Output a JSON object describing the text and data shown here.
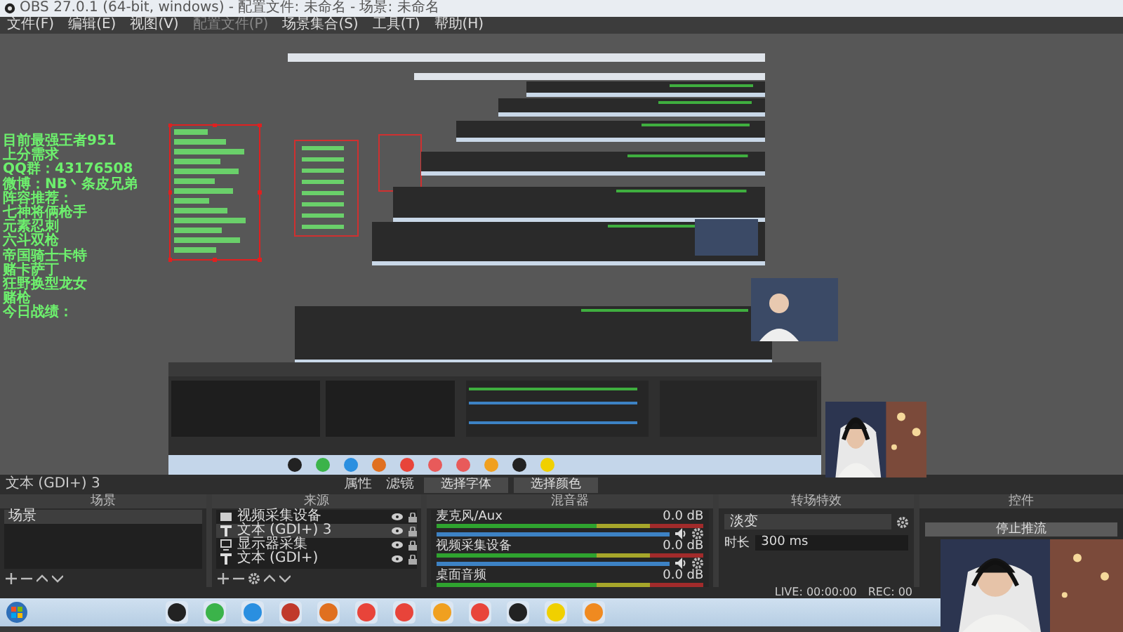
{
  "window": {
    "title": "OBS 27.0.1 (64-bit, windows) - 配置文件: 未命名 - 场景: 未命名"
  },
  "menu": [
    {
      "label": "文件(F)",
      "disabled": false
    },
    {
      "label": "编辑(E)",
      "disabled": false
    },
    {
      "label": "视图(V)",
      "disabled": false
    },
    {
      "label": "配置文件(P)",
      "disabled": true
    },
    {
      "label": "场景集合(S)",
      "disabled": false
    },
    {
      "label": "工具(T)",
      "disabled": false
    },
    {
      "label": "帮助(H)",
      "disabled": false
    }
  ],
  "preview": {
    "text_lines": [
      "目前最强王者951",
      "上分需求",
      "QQ群：43176508",
      "微博：NB丶条皮兄弟",
      "阵容推荐：",
      "七神将俩枪手",
      "元素忍刺",
      "六斗双枪",
      "帝国骑士卡特",
      "赌卡萨丁",
      "狂野换型龙女",
      "赌枪",
      "今日战绩："
    ]
  },
  "source_toolbar": {
    "source": "文本 (GDI+) 3",
    "buttons": [
      "属性",
      "滤镜",
      "选择字体",
      "选择颜色"
    ]
  },
  "scenes": {
    "title": "场景",
    "items": [
      {
        "label": "场景",
        "selected": true
      }
    ]
  },
  "sources": {
    "title": "来源",
    "items": [
      {
        "label": "视频采集设备",
        "kind": "camera",
        "selected": false
      },
      {
        "label": "文本 (GDI+) 3",
        "kind": "text",
        "selected": true
      },
      {
        "label": "显示器采集",
        "kind": "monitor",
        "selected": false
      },
      {
        "label": "文本 (GDI+)",
        "kind": "text",
        "selected": false
      }
    ]
  },
  "mixer": {
    "title": "混音器",
    "channels": [
      {
        "name": "麦克风/Aux",
        "reading": "0.0 dB",
        "level": 1
      },
      {
        "name": "视频采集设备",
        "reading": "0.0 dB",
        "level": 1
      },
      {
        "name": "桌面音频",
        "reading": "0.0 dB"
      }
    ]
  },
  "transitions": {
    "title": "转场特效",
    "transition": "淡变",
    "duration_label": "时长",
    "duration": "300 ms"
  },
  "controls": {
    "title": "控件",
    "buttons": [
      "停止推流"
    ]
  },
  "status_bar": {
    "live": "LIVE: 00:00:00",
    "rec": "REC: 00"
  }
}
